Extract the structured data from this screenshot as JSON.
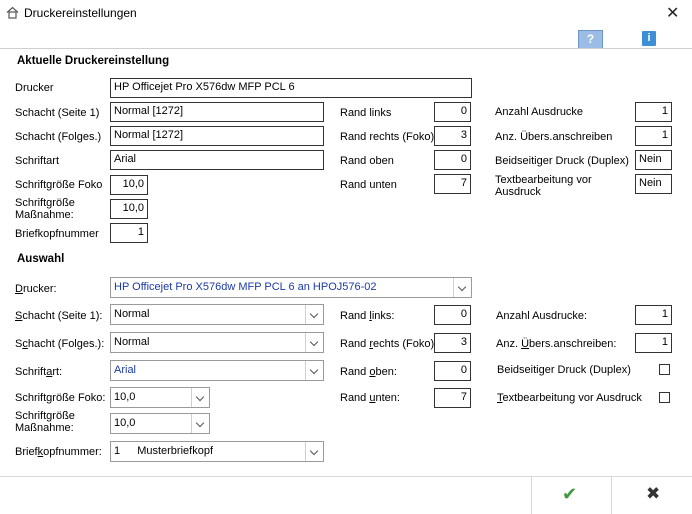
{
  "window": {
    "title": "Druckereinstellungen",
    "close_glyph": "✕"
  },
  "toolbar": {
    "help_label": "?",
    "info_label": "i"
  },
  "current": {
    "section_title": "Aktuelle Druckereinstellung",
    "printer_label": "Drucker",
    "printer_value": "HP Officejet Pro X576dw MFP PCL 6",
    "tray1_label": "Schacht (Seite 1)",
    "tray1_value": "Normal [1272]",
    "trayn_label": "Schacht (Folges.)",
    "trayn_value": "Normal [1272]",
    "font_label": "Schriftart",
    "font_value": "Arial",
    "fontsize_foko_label": "Schriftgröße Foko",
    "fontsize_foko_value": "10,0",
    "fontsize_mass_label_1": "Schriftgröße",
    "fontsize_mass_label_2": "Maßnahme:",
    "fontsize_mass_value": "10,0",
    "letterhead_label": "Briefkopfnummer",
    "letterhead_value": "1",
    "margin_left_label": "Rand links",
    "margin_left_value": "0",
    "margin_right_label": "Rand rechts (Foko)",
    "margin_right_value": "3",
    "margin_top_label": "Rand oben",
    "margin_top_value": "0",
    "margin_bottom_label": "Rand unten",
    "margin_bottom_value": "7",
    "copies_label": "Anzahl Ausdrucke",
    "copies_value": "1",
    "overwrite_label": "Anz. Übers.anschreiben",
    "overwrite_value": "1",
    "duplex_label": "Beidseitiger Druck (Duplex)",
    "duplex_value": "Nein",
    "textedit_label_1": "Textbearbeitung vor",
    "textedit_label_2": "Ausdruck",
    "textedit_value": "Nein"
  },
  "selection": {
    "section_title": "Auswahl",
    "printer_label_pre": "",
    "printer_label_u": "D",
    "printer_label_post": "rucker:",
    "printer_value": "HP Officejet Pro X576dw MFP PCL 6 an HPOJ576-02",
    "tray1_label_u": "S",
    "tray1_label_post": "chacht (Seite 1):",
    "tray1_value": "Normal",
    "trayn_label_pre": "S",
    "trayn_label_u": "c",
    "trayn_label_post": "hacht (Folges.):",
    "trayn_value": "Normal",
    "font_label_pre": "Schrift",
    "font_label_u": "a",
    "font_label_post": "rt:",
    "font_value": "Arial",
    "fontsize_foko_label": "Schriftgröße Foko:",
    "fontsize_foko_value": "10,0",
    "fontsize_mass_label_1": "Schriftgröße",
    "fontsize_mass_label_2": "Maßnahme:",
    "fontsize_mass_value": "10,0",
    "letterhead_label_pre": "Brief",
    "letterhead_label_u": "k",
    "letterhead_label_post": "opfnummer:",
    "letterhead_value_num": "1",
    "letterhead_value_text": "Musterbriefkopf",
    "margin_left_label_pre": "Rand ",
    "margin_left_label_u": "l",
    "margin_left_label_post": "inks:",
    "margin_left_value": "0",
    "margin_right_label_pre": "Rand ",
    "margin_right_label_u": "r",
    "margin_right_label_post": "echts (Foko):",
    "margin_right_value": "3",
    "margin_top_label_pre": "Rand ",
    "margin_top_label_u": "o",
    "margin_top_label_post": "ben:",
    "margin_top_value": "0",
    "margin_bottom_label_pre": "Rand ",
    "margin_bottom_label_u": "u",
    "margin_bottom_label_post": "nten:",
    "margin_bottom_value": "7",
    "copies_label": "Anzahl Ausdrucke:",
    "copies_value": "1",
    "overwrite_label_pre": "Anz. ",
    "overwrite_label_u": "Ü",
    "overwrite_label_post": "bers.anschreiben:",
    "overwrite_value": "1",
    "duplex_label": "Beidseitiger Druck (Duplex)",
    "textedit_label_u": "T",
    "textedit_label_post": "extbearbeitung vor Ausdruck"
  },
  "footer": {
    "ok_glyph": "✔",
    "cancel_glyph": "✖"
  }
}
